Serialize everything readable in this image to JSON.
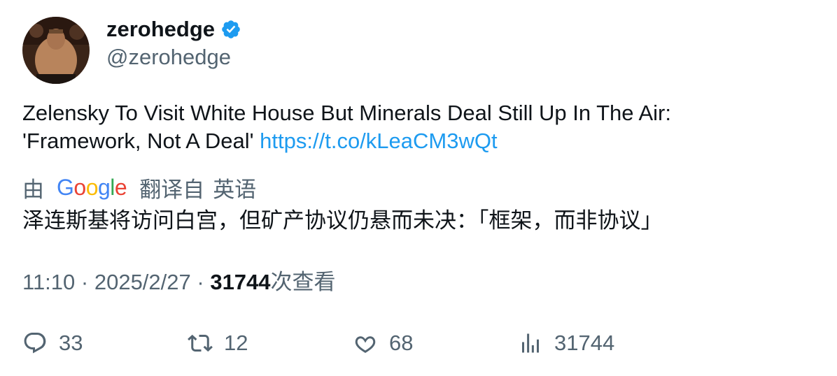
{
  "user": {
    "display_name": "zerohedge",
    "handle": "@zerohedge",
    "verified_icon": "verified-badge-icon",
    "avatar": "avatar"
  },
  "tweet": {
    "text_line1": "Zelensky To Visit White House But Minerals Deal Still Up In The Air:",
    "text_line2": "'Framework, Not A Deal' ",
    "link": "https://t.co/kLeaCM3wQt"
  },
  "translation": {
    "prefix": "由",
    "provider": "Google",
    "provider_letters": [
      "G",
      "o",
      "o",
      "g",
      "l",
      "e"
    ],
    "provider_colors": [
      "#4285F4",
      "#EA4335",
      "#FBBC05",
      "#4285F4",
      "#34A853",
      "#EA4335"
    ],
    "translated_from": "翻译自",
    "source_language": "英语",
    "text": "泽连斯基将访问白宫，但矿产协议仍悬而未决：「框架，而非协议」"
  },
  "meta": {
    "time": "11:10",
    "separator": " · ",
    "date": "2025/2/27",
    "views_count": "31744",
    "views_label": "次查看"
  },
  "actions": {
    "reply": {
      "icon": "reply-icon",
      "count": "33"
    },
    "retweet": {
      "icon": "retweet-icon",
      "count": "12"
    },
    "like": {
      "icon": "heart-icon",
      "count": "68"
    },
    "views": {
      "icon": "views-chart-icon",
      "count": "31744"
    }
  },
  "colors": {
    "text_primary": "#0f1419",
    "text_secondary": "#536471",
    "link": "#1d9bf0",
    "verified": "#1d9bf0"
  }
}
